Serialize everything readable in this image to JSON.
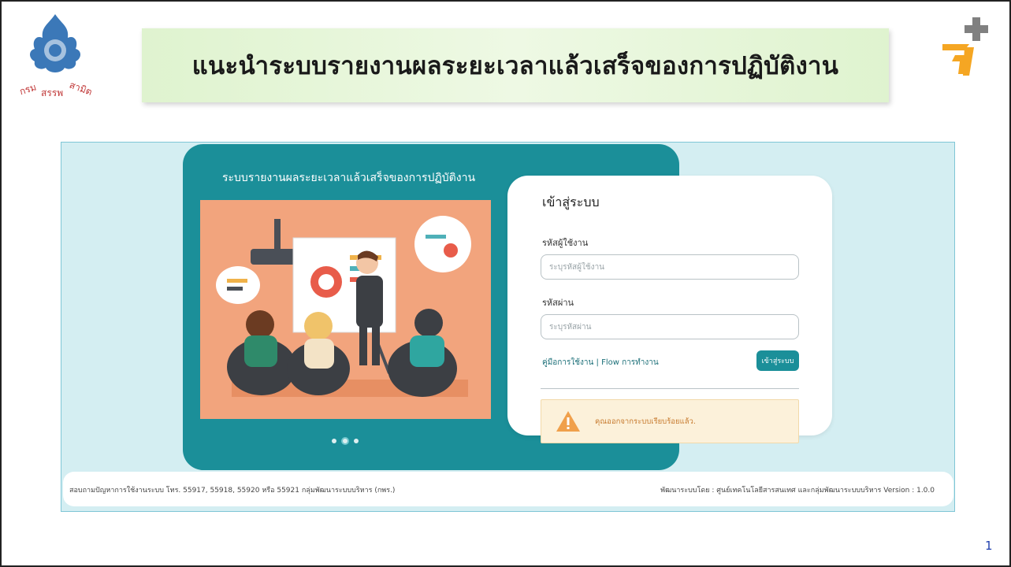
{
  "slide": {
    "title": "แนะนำระบบรายงานผลระยะเวลาแล้วเสร็จของการปฏิบัติงาน",
    "page_number": "1",
    "seal_text": "กรมสรรพสามิต"
  },
  "app": {
    "header_title": "ระบบรายงานผลระยะเวลาแล้วเสร็จของการปฏิบัติงาน",
    "carousel": {
      "slides": 3,
      "active_index": 1
    },
    "login": {
      "title": "เข้าสู่ระบบ",
      "username_label": "รหัสผู้ใช้งาน",
      "username_placeholder": "ระบุรหัสผู้ใช้งาน",
      "username_value": "",
      "password_label": "รหัสผ่าน",
      "password_placeholder": "ระบุรหัสผ่าน",
      "password_value": "",
      "manual_link": "คู่มือการใช้งาน",
      "separator": "|",
      "flow_link": "Flow การทำงาน",
      "login_button": "เข้าสู่ระบบ"
    },
    "alert": {
      "icon": "warning-icon",
      "message": "คุณออกจากระบบเรียบร้อยแล้ว."
    },
    "footer": {
      "left": "สอบถามปัญหาการใช้งานระบบ โทร. 55917, 55918, 55920 หรือ 55921 กลุ่มพัฒนาระบบบริหาร (กพร.)",
      "right": "พัฒนาระบบโดย : ศูนย์เทคโนโลยีสารสนเทศ และกลุ่มพัฒนาระบบบริหาร Version : 1.0.0"
    }
  },
  "colors": {
    "teal": "#1b8f99",
    "screen_bg": "#d4eef2",
    "banner_green": "#dff3cf",
    "illustration_bg": "#f2a47d",
    "alert_bg": "#fcf1da",
    "page_number": "#1f3fae",
    "logo_orange": "#f5a623",
    "logo_gray": "#808080"
  }
}
